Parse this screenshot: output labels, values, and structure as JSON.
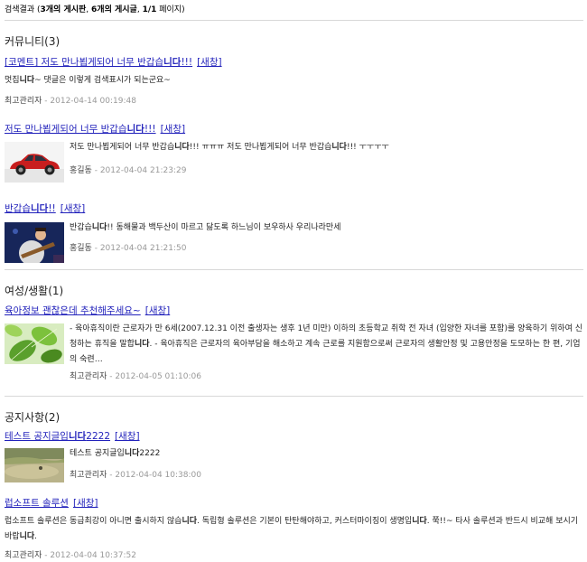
{
  "summary": {
    "prefix": "검색결과 (",
    "boards": "3개의 게시판",
    "sep1": ", ",
    "posts": "6개의 게시글",
    "sep2": ", ",
    "pages": "1/1",
    "suffix": " 페이지)"
  },
  "sections": [
    {
      "title": "커뮤니티(3)"
    },
    {
      "title": "여성/생활(1)"
    },
    {
      "title": "공지사항(2)"
    }
  ],
  "new_window_label": "[새창]",
  "posts": [
    {
      "title_a": "[코멘트] 저도 만나뵙게되어 너무 반갑습",
      "title_b": "니다",
      "title_c": "!!!",
      "text_a": "멋집",
      "text_b": "니다",
      "text_c": "~ 댓글은 이렇게 검색표시가 되는군요~",
      "author": "최고관리자",
      "date": "2012-04-14 00:19:48"
    },
    {
      "title_a": "저도 만나뵙게되어 너무 반갑습",
      "title_b": "니다",
      "title_c": "!!!",
      "text_a": "저도 만나뵙게되어 너무 반갑습",
      "text_b": "니다",
      "text_c": "!!! ㅠㅠㅠ 저도 만나뵙게되어 너무 반갑습",
      "text_d": "니다",
      "text_e": "!!! ㅜㅜㅜㅜ",
      "author": "홍길동",
      "date": "2012-04-04 21:23:29"
    },
    {
      "title_a": "반갑습",
      "title_b": "니다",
      "title_c": "!!",
      "text_a": "반갑습",
      "text_b": "니다",
      "text_c": "!! 동해물과 백두산이 마르고 닳도록 하느님이 보우하사 우리나라만세",
      "author": "홍길동",
      "date": "2012-04-04 21:21:50"
    },
    {
      "title": "육아정보 괜찮은데 추천해주세요~",
      "text_a": "- 육아휴직이란 근로자가 만 6세(2007.12.31 이전 출생자는 생후 1년 미만) 이하의 초등학교 취학 전 자녀 (입양한 자녀를 포함)를 양육하기 위하여",
      "text_b": "신청하는 휴직을 말합",
      "text_c": "니다",
      "text_d": ". - 육아휴직은 근로자의 육아부담을 해소하고 계속 근로를 지원함으로써 근로자의 생활안정 및 고용안정을 도모하는 한",
      "text_e": "편, 기업의 숙련…",
      "author": "최고관리자",
      "date": "2012-04-05 01:10:06"
    },
    {
      "title_a": "테스트 공지글입",
      "title_b": "니다",
      "title_c": "2222",
      "text_a": "테스트 공지글입",
      "text_b": "니다",
      "text_c": "2222",
      "author": "최고관리자",
      "date": "2012-04-04 10:38:00"
    },
    {
      "title": "럽소프트 솔루션",
      "text_a": "럽소프트 솔루션은 동급최강이 아니면 출시하지 않습",
      "text_b": "니다",
      "text_c": ". 독립형 솔루션은 기본이 탄탄해야하고, 커스터마이징이 생명입",
      "text_d": "니다",
      "text_e": ". 쭉!!~ 타사 솔루션과 반드시 비교해",
      "text_f": "보시기 바랍",
      "text_g": "니다",
      "text_h": ".",
      "author": "최고관리자",
      "date": "2012-04-04 10:37:52"
    }
  ]
}
